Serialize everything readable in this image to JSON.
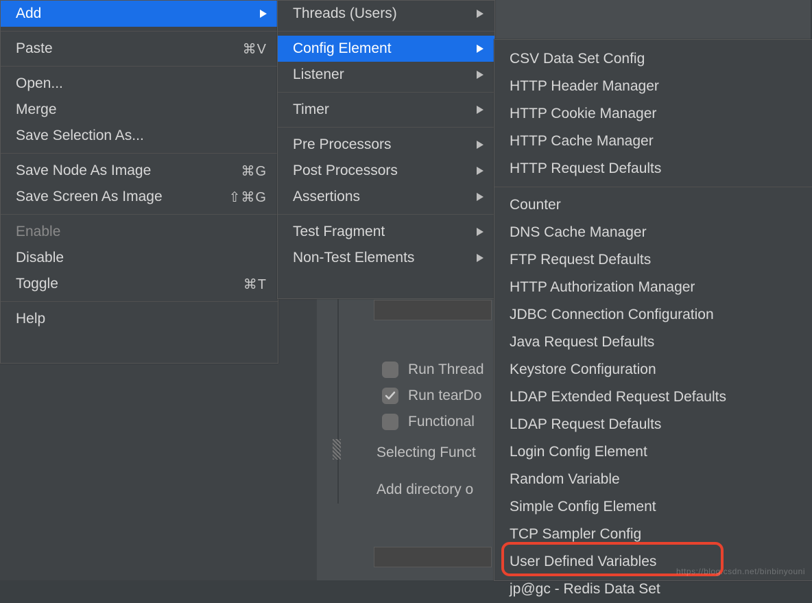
{
  "menu1": {
    "add": "Add",
    "paste": "Paste",
    "paste_sc": "⌘V",
    "open": "Open...",
    "merge": "Merge",
    "save_sel": "Save Selection As...",
    "save_node": "Save Node As Image",
    "save_node_sc": "⌘G",
    "save_screen": "Save Screen As Image",
    "save_screen_sc": "⇧⌘G",
    "enable": "Enable",
    "disable": "Disable",
    "toggle": "Toggle",
    "toggle_sc": "⌘T",
    "help": "Help"
  },
  "menu2": {
    "threads": "Threads (Users)",
    "config": "Config Element",
    "listener": "Listener",
    "timer": "Timer",
    "pre": "Pre Processors",
    "post": "Post Processors",
    "assert": "Assertions",
    "frag": "Test Fragment",
    "nontest": "Non-Test Elements"
  },
  "menu3": {
    "csv": "CSV Data Set Config",
    "http_hdr": "HTTP Header Manager",
    "http_cookie": "HTTP Cookie Manager",
    "http_cache": "HTTP Cache Manager",
    "http_req": "HTTP Request Defaults",
    "counter": "Counter",
    "dns": "DNS Cache Manager",
    "ftp": "FTP Request Defaults",
    "http_auth": "HTTP Authorization Manager",
    "jdbc": "JDBC Connection Configuration",
    "java": "Java Request Defaults",
    "keystore": "Keystore Configuration",
    "ldap_ext": "LDAP Extended Request Defaults",
    "ldap": "LDAP Request Defaults",
    "login": "Login Config Element",
    "random": "Random Variable",
    "simple": "Simple Config Element",
    "tcp": "TCP Sampler Config",
    "userdef": "User Defined Variables",
    "redis": "jp@gc - Redis Data Set"
  },
  "bg": {
    "run_thread": "Run Thread",
    "run_teardown": "Run tearDo",
    "functional": "Functional ",
    "selecting": "Selecting Funct",
    "add_dir": "Add directory o"
  },
  "watermark": "https://blog.csdn.net/binbinyouni"
}
